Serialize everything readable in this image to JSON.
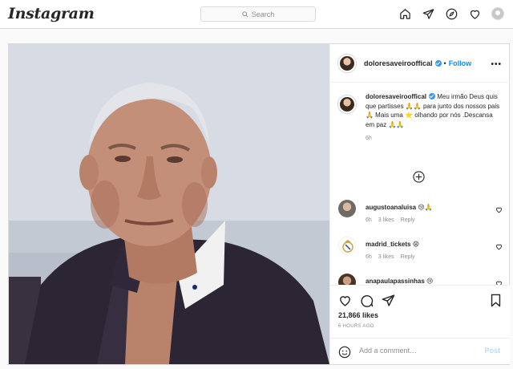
{
  "app": {
    "logo": "Instagram"
  },
  "search": {
    "placeholder": "Search"
  },
  "nav": {
    "icons": [
      "home-icon",
      "direct-icon",
      "explore-icon",
      "activity-heart-icon",
      "profile-avatar"
    ]
  },
  "post": {
    "username": "doloresaveirooffical",
    "verified": true,
    "follow_label": "Follow",
    "caption_user": "doloresaveirooffical",
    "caption_text": "Meu irmão Deus quis que partisses 🙏🙏 para junto dos nossos pais 🙏 Mais uma ⭐ olhando por nós .Descansa em paz 🙏🙏",
    "caption_time": "6h",
    "comments": [
      {
        "user": "augustoanaluisa",
        "text": "😢🙏",
        "time": "6h",
        "likes": "3 likes",
        "reply": "Reply"
      },
      {
        "user": "madrid_tickets",
        "text": "😩",
        "time": "6h",
        "likes": "3 likes",
        "reply": "Reply"
      },
      {
        "user": "anapaulapassinhas",
        "text": "😢",
        "time": "",
        "likes": "",
        "reply": ""
      }
    ],
    "likes": "21,866 likes",
    "time_ago": "6 HOURS AGO",
    "add_comment_placeholder": "Add a comment…",
    "post_label": "Post"
  },
  "colors": {
    "accent": "#0095f6",
    "verified": "#3897f0",
    "border": "#dbdbdb",
    "muted": "#8e8e8e"
  }
}
